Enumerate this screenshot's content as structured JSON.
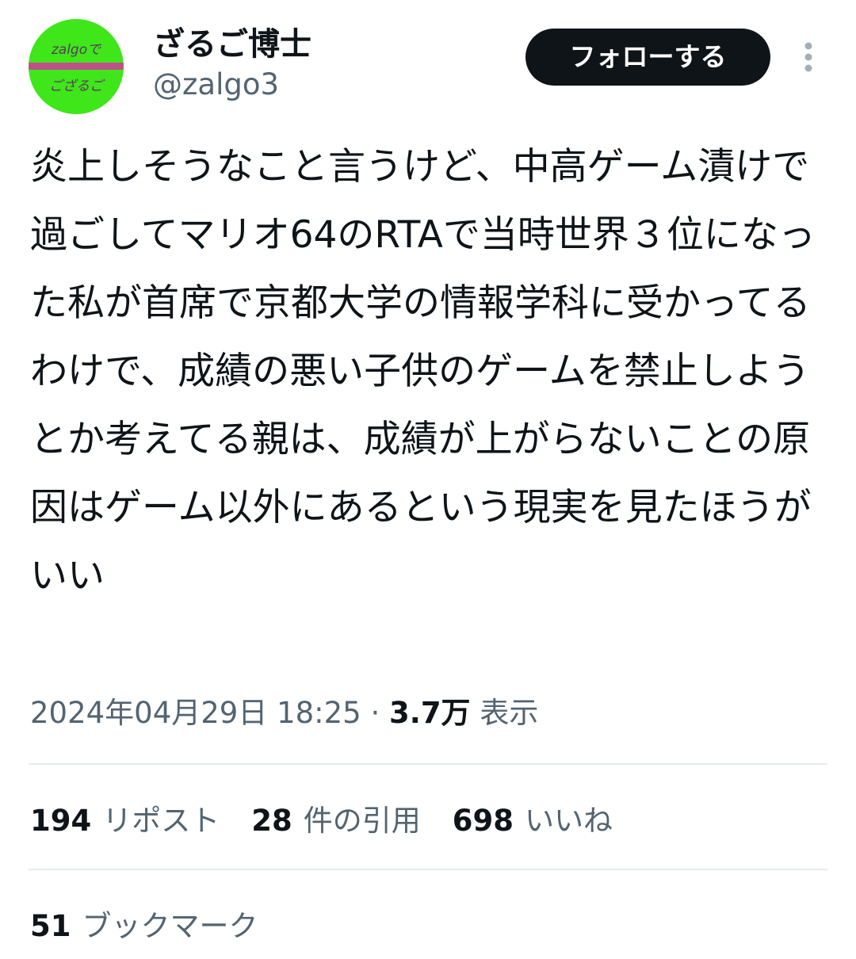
{
  "profile": {
    "avatar_top_text": "zalgoで",
    "avatar_bottom_text": "ござるご",
    "display_name": "ざるご博士",
    "handle": "@zalgo3",
    "follow_label": "フォローする",
    "more_icon": "more-vertical-icon"
  },
  "tweet": {
    "text": "炎上しそうなこと言うけど、中高ゲーム漬けで過ごしてマリオ64のRTAで当時世界３位になった私が首席で京都大学の情報学科に受かってるわけで、成績の悪い子供のゲームを禁止しようとか考えてる親は、成績が上がらないことの原因はゲーム以外にあるという現実を見たほうがいい"
  },
  "meta": {
    "timestamp": "2024年04月29日 18:25",
    "separator": " · ",
    "views_count": "3.7万",
    "views_label": " 表示"
  },
  "stats": {
    "reposts_count": "194",
    "reposts_label": "リポスト",
    "quotes_count": "28",
    "quotes_label": "件の引用",
    "likes_count": "698",
    "likes_label": "いいね",
    "bookmarks_count": "51",
    "bookmarks_label": "ブックマーク"
  },
  "colors": {
    "text_primary": "#0f1419",
    "text_secondary": "#536471",
    "divider": "#e7ebee",
    "avatar_bg": "#3ee61a",
    "avatar_stripe": "#c0508a"
  }
}
